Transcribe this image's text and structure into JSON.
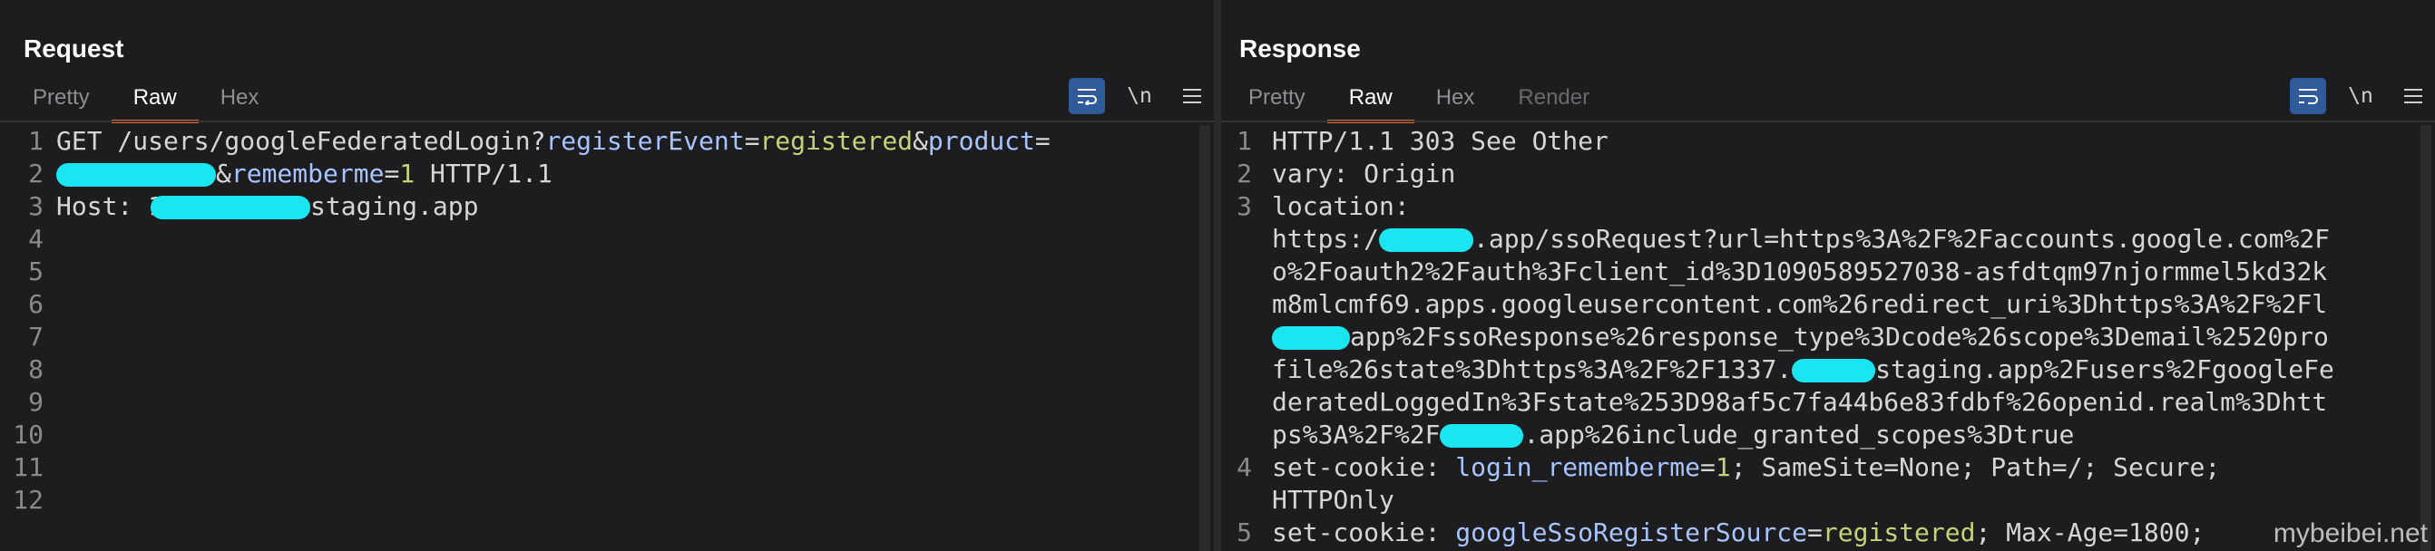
{
  "request": {
    "title": "Request",
    "tabs": [
      "Pretty",
      "Raw",
      "Hex"
    ],
    "active_tab": "Raw",
    "line_numbers": [
      "1",
      "2",
      "3",
      "4",
      "5",
      "6",
      "7",
      "8",
      "9",
      "10",
      "11",
      "12"
    ],
    "lines": {
      "l1_a": "GET /users/googleFederatedLogin?",
      "l1_k1": "registerEvent",
      "l1_eq1": "=",
      "l1_v1": "registered",
      "l1_amp1": "&",
      "l1_k2": "product",
      "l1_eq2": "=",
      "l2_amp": "&",
      "l2_k": "rememberme",
      "l2_eq": "=",
      "l2_v": "1",
      "l2_rest": " HTTP/1.1",
      "l3_a": "Host: 1",
      "l3_b": "staging.app"
    }
  },
  "response": {
    "title": "Response",
    "tabs": [
      "Pretty",
      "Raw",
      "Hex",
      "Render"
    ],
    "active_tab": "Raw",
    "line_numbers": [
      "1",
      "2",
      "3",
      "",
      "",
      "",
      "",
      "",
      "",
      "",
      "4",
      "",
      "5"
    ],
    "lines": {
      "r1": "HTTP/1.1 303 See Other",
      "r2_k": "vary",
      "r2_v": ": Origin",
      "r3_k": "location",
      "r3_v": ":",
      "r4_a": "https:/",
      "r4_b": ".app/ssoRequest?url=https%3A%2F%2Faccounts.google.com%2F",
      "r5": "o%2Foauth2%2Fauth%3Fclient_id%3D1090589527038-asfdtqm97njormmel5kd32k",
      "r6": "m8mlcmf69.apps.googleusercontent.com%26redirect_uri%3Dhttps%3A%2F%2Fl",
      "r7_b": "app%2FssoResponse%26response_type%3Dcode%26scope%3Demail%2520pro",
      "r8_a": "file%26state%3Dhttps%3A%2F%2F1337.",
      "r8_b": "staging.app%2Fusers%2FgoogleFe",
      "r9": "deratedLoggedIn%3Fstate%253D98af5c7fa44b6e83fdbf%26openid.realm%3Dhtt",
      "r10_a": "ps%3A%2F%2F",
      "r10_b": ".app%26include_granted_scopes%3Dtrue",
      "r11_k": "set-cookie",
      "r11_a": ": ",
      "r11_ck": "login_rememberme",
      "r11_eq": "=",
      "r11_cv": "1",
      "r11_rest": "; SameSite=None; Path=/; Secure;",
      "r12": "HTTPOnly",
      "r13_k": "set-cookie",
      "r13_a": ": ",
      "r13_ck": "googleSsoRegisterSource",
      "r13_eq": "=",
      "r13_cv": "registered",
      "r13_rest": "; Max-Age=1800;"
    }
  },
  "toolbar": {
    "wrap_icon": "wrap-lines-icon",
    "newline_label": "\\n",
    "menu_icon": "hamburger-menu-icon"
  },
  "layout_buttons": [
    "split-horizontal-icon",
    "split-vertical-icon",
    "single-pane-icon"
  ],
  "watermark": "mybeibei.net",
  "colors": {
    "accent_tab": "#e8662b",
    "toggle_on": "#2f5b9a",
    "key": "#a8c4ff",
    "value": "#c3d37a",
    "redaction": "#19e6f0"
  }
}
